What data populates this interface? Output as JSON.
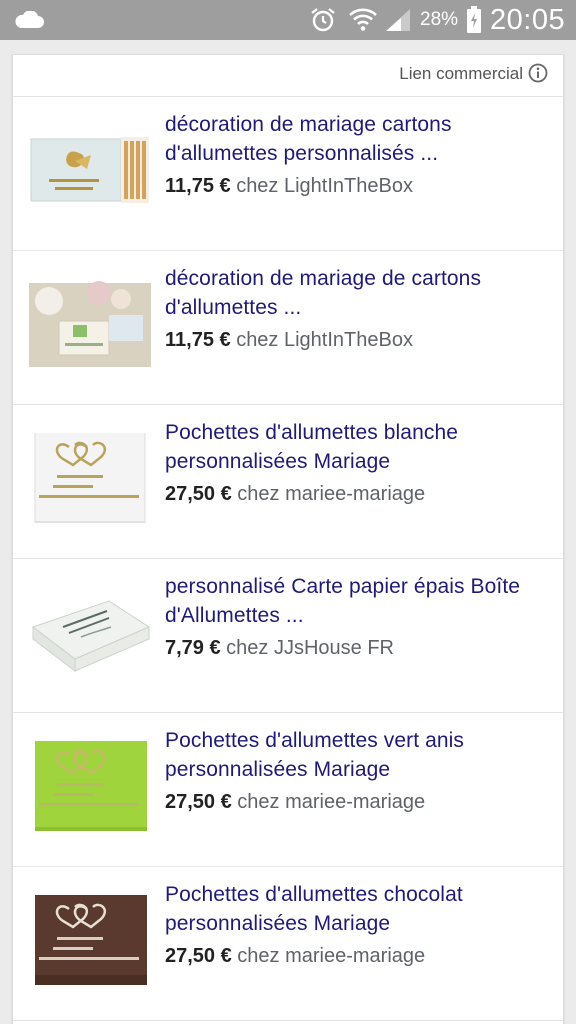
{
  "status_bar": {
    "battery_percent": "28%",
    "time": "20:05",
    "icons": [
      "cloud-icon",
      "alarm-icon",
      "wifi-icon",
      "signal-icon",
      "battery-charging-icon"
    ]
  },
  "ad_header": {
    "label": "Lien commercial",
    "icon": "info-icon"
  },
  "results": [
    {
      "title": "décoration de mariage cartons d'allumettes personnalisés ...",
      "price": "11,75 €",
      "seller": "chez LightInTheBox",
      "thumb_colors": [
        "#dfe9ea",
        "#c8a24a"
      ]
    },
    {
      "title": "décoration de mariage de cartons d'allumettes ...",
      "price": "11,75 €",
      "seller": "chez LightInTheBox",
      "thumb_colors": [
        "#d9d2c0",
        "#8bbf6a"
      ]
    },
    {
      "title": "Pochettes d'allumettes blanche personnalisées Mariage",
      "price": "27,50 €",
      "seller": "chez mariee-mariage",
      "thumb_colors": [
        "#f4f4f4",
        "#b9a25a"
      ]
    },
    {
      "title": "personnalisé Carte papier épais Boîte d'Allumettes ...",
      "price": "7,79 €",
      "seller": "chez JJsHouse FR",
      "thumb_colors": [
        "#f0f2ef",
        "#5a6b6a"
      ]
    },
    {
      "title": "Pochettes d'allumettes vert anis personnalisées Mariage",
      "price": "27,50 €",
      "seller": "chez mariee-mariage",
      "thumb_colors": [
        "#9fd43c",
        "#c8b86a"
      ]
    },
    {
      "title": "Pochettes d'allumettes chocolat personnalisées Mariage",
      "price": "27,50 €",
      "seller": "chez mariee-mariage",
      "thumb_colors": [
        "#5a3a2e",
        "#e8e0d4"
      ]
    }
  ]
}
